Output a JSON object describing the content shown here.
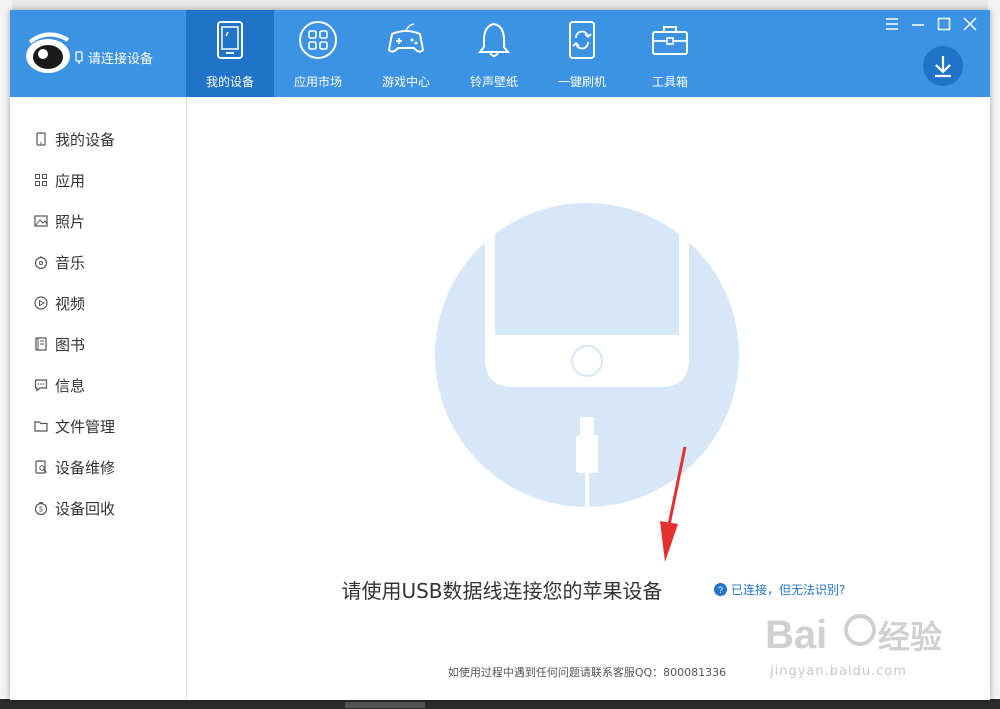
{
  "app": {
    "connect_status": "请连接设备"
  },
  "tabs": [
    {
      "label": "我的设备",
      "icon": "tablet-icon",
      "active": true
    },
    {
      "label": "应用市场",
      "icon": "apps-grid-icon",
      "active": false
    },
    {
      "label": "游戏中心",
      "icon": "gamepad-icon",
      "active": false
    },
    {
      "label": "铃声壁纸",
      "icon": "bell-icon",
      "active": false
    },
    {
      "label": "一键刷机",
      "icon": "flash-refresh-icon",
      "active": false
    },
    {
      "label": "工具箱",
      "icon": "toolbox-icon",
      "active": false
    }
  ],
  "sidebar": {
    "items": [
      {
        "label": "我的设备",
        "icon": "phone-icon"
      },
      {
        "label": "应用",
        "icon": "apps-icon"
      },
      {
        "label": "照片",
        "icon": "photo-icon"
      },
      {
        "label": "音乐",
        "icon": "music-icon"
      },
      {
        "label": "视频",
        "icon": "video-icon"
      },
      {
        "label": "图书",
        "icon": "book-icon"
      },
      {
        "label": "信息",
        "icon": "message-icon"
      },
      {
        "label": "文件管理",
        "icon": "folder-icon"
      },
      {
        "label": "设备维修",
        "icon": "repair-icon"
      },
      {
        "label": "设备回收",
        "icon": "recycle-icon"
      }
    ]
  },
  "content": {
    "prompt": "请使用USB数据线连接您的苹果设备",
    "help_link": "已连接，但无法识别?",
    "footer": "如使用过程中遇到任何问题请联系客服QQ：800081336"
  },
  "watermark": {
    "text": "jingyan.baidu.com"
  },
  "colors": {
    "header": "#3c92e3",
    "active_tab": "#1f74c9",
    "illustration": "#d6e8f8"
  }
}
